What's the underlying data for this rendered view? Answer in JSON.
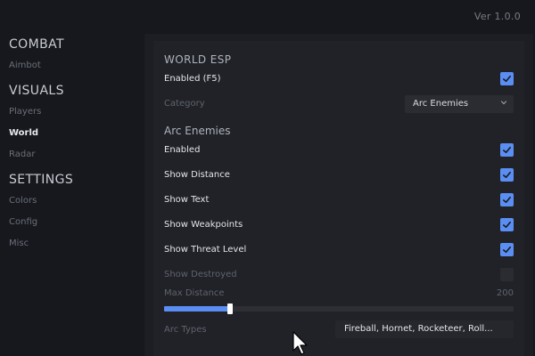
{
  "version": "Ver 1.0.0",
  "sidebar": {
    "sections": [
      {
        "title": "COMBAT",
        "items": [
          {
            "label": "Aimbot",
            "active": false
          }
        ]
      },
      {
        "title": "VISUALS",
        "items": [
          {
            "label": "Players",
            "active": false
          },
          {
            "label": "World",
            "active": true
          },
          {
            "label": "Radar",
            "active": false
          }
        ]
      },
      {
        "title": "SETTINGS",
        "items": [
          {
            "label": "Colors",
            "active": false
          },
          {
            "label": "Config",
            "active": false
          },
          {
            "label": "Misc",
            "active": false
          }
        ]
      }
    ]
  },
  "panel": {
    "heading": "WORLD ESP",
    "enabled_label": "Enabled (F5)",
    "enabled_checked": true,
    "category_label": "Category",
    "category_value": "Arc Enemies",
    "section_title": "Arc Enemies",
    "options": [
      {
        "label": "Enabled",
        "checked": true,
        "disabled": false
      },
      {
        "label": "Show Distance",
        "checked": true,
        "disabled": false
      },
      {
        "label": "Show Text",
        "checked": true,
        "disabled": false
      },
      {
        "label": "Show Weakpoints",
        "checked": true,
        "disabled": false
      },
      {
        "label": "Show Threat Level",
        "checked": true,
        "disabled": false
      },
      {
        "label": "Show Destroyed",
        "checked": false,
        "disabled": true
      }
    ],
    "max_distance": {
      "label": "Max Distance",
      "value": "200",
      "fraction": 0.19
    },
    "arc_types": {
      "label": "Arc Types",
      "value": "Fireball, Hornet, Rocketeer, Roll..."
    }
  },
  "colors": {
    "accent": "#5b8ef2",
    "background": "#17181d"
  }
}
